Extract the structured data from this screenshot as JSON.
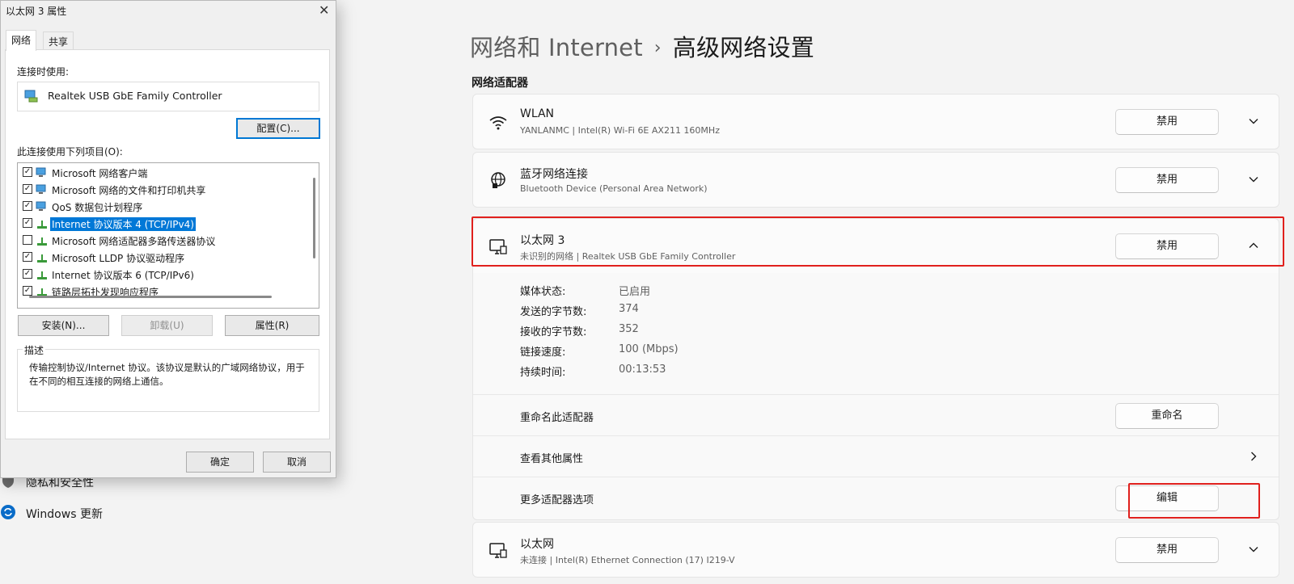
{
  "settings": {
    "breadcrumb_parent": "网络和 Internet",
    "breadcrumb_sep": "›",
    "breadcrumb_current": "高级网络设置",
    "section_title": "网络适配器",
    "adapters": [
      {
        "name": "WLAN",
        "desc": "YANLANMC | Intel(R) Wi-Fi 6E AX211 160MHz",
        "button": "禁用"
      },
      {
        "name": "蓝牙网络连接",
        "desc": "Bluetooth Device (Personal Area Network)",
        "button": "禁用"
      },
      {
        "name": "以太网 3",
        "desc": "未识别的网络 | Realtek USB GbE Family Controller",
        "button": "禁用"
      },
      {
        "name": "以太网",
        "desc": "未连接 | Intel(R) Ethernet Connection (17) I219-V",
        "button": "禁用"
      }
    ],
    "details": [
      {
        "label": "媒体状态:",
        "value": "已启用"
      },
      {
        "label": "发送的字节数:",
        "value": "374"
      },
      {
        "label": "接收的字节数:",
        "value": "352"
      },
      {
        "label": "链接速度:",
        "value": "100 (Mbps)"
      },
      {
        "label": "持续时间:",
        "value": "00:13:53"
      }
    ],
    "rename_label": "重命名此适配器",
    "rename_button": "重命名",
    "more_props_label": "查看其他属性",
    "more_options_label": "更多适配器选项",
    "edit_button": "编辑"
  },
  "nav": {
    "privacy": "隐私和安全性",
    "windows_update": "Windows 更新"
  },
  "dialog": {
    "title": "以太网 3 属性",
    "close": "✕",
    "tabs": [
      "网络",
      "共享"
    ],
    "connect_using_label": "连接时使用:",
    "device": "Realtek USB GbE Family Controller",
    "configure_button": "配置(C)...",
    "items_label": "此连接使用下列项目(O):",
    "items": [
      {
        "text": "Microsoft 网络客户端",
        "checked": true
      },
      {
        "text": "Microsoft 网络的文件和打印机共享",
        "checked": true
      },
      {
        "text": "QoS 数据包计划程序",
        "checked": true
      },
      {
        "text": "Internet 协议版本 4 (TCP/IPv4)",
        "checked": true
      },
      {
        "text": "Microsoft 网络适配器多路传送器协议",
        "checked": false
      },
      {
        "text": "Microsoft LLDP 协议驱动程序",
        "checked": true
      },
      {
        "text": "Internet 协议版本 6 (TCP/IPv6)",
        "checked": true
      },
      {
        "text": "链路层拓扑发现响应程序",
        "checked": true
      }
    ],
    "selected_index": 3,
    "install_button": "安装(N)...",
    "uninstall_button": "卸载(U)",
    "properties_button": "属性(R)",
    "description_legend": "描述",
    "description_text": "传输控制协议/Internet 协议。该协议是默认的广域网络协议，用于在不同的相互连接的网络上通信。",
    "ok_button": "确定",
    "cancel_button": "取消"
  },
  "colors": {
    "highlight_red": "#e0201d",
    "selection_blue": "#0078d7"
  }
}
